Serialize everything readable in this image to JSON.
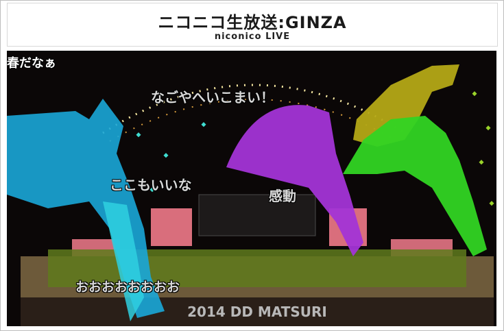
{
  "header": {
    "title": "ニコニコ生放送:GINZA",
    "subtitle": "niconico LIVE"
  },
  "video": {
    "banner_text": "2014 DD MATSURI",
    "comments": [
      {
        "text": "春だなぁ"
      },
      {
        "text": "なごやへいこまい！"
      },
      {
        "text": "ここもいいな"
      },
      {
        "text": "感動"
      },
      {
        "text": "おおおおおおおお"
      }
    ]
  },
  "colors": {
    "cyan_ascii_art": "#1aa7d8",
    "purple_ascii_art": "#a030d0",
    "yellow_ascii_art": "#b6aa14",
    "green_ascii_art": "#2ed220",
    "stage_pink": "#e06c7a"
  }
}
